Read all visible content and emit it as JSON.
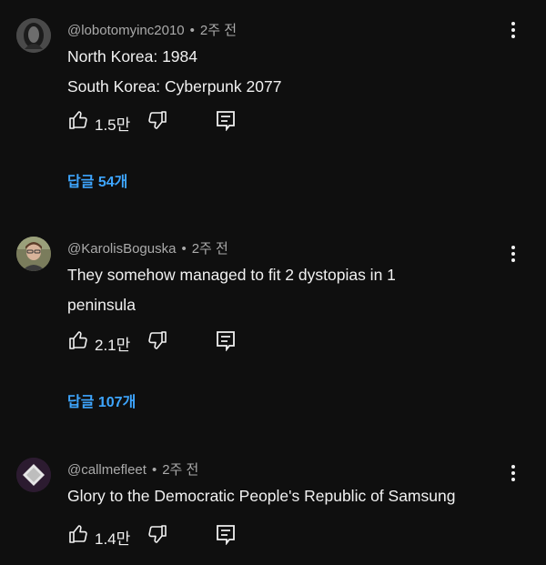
{
  "colors": {
    "background": "#0f0f0f",
    "text": "#f1f1f1",
    "meta": "#aaaaaa",
    "link": "#3ea6ff"
  },
  "comments": [
    {
      "handle": "@lobotomyinc2010",
      "separator": "•",
      "time": "2주 전",
      "lines": [
        "North Korea: 1984",
        "South Korea: Cyberpunk 2077"
      ],
      "likes": "1.5만",
      "replies": "답글 54개",
      "avatar_icon": "masked-face-avatar"
    },
    {
      "handle": "@KarolisBoguska",
      "separator": "•",
      "time": "2주 전",
      "lines": [
        "They somehow managed to fit 2 dystopias in 1",
        "peninsula"
      ],
      "likes": "2.1만",
      "replies": "답글 107개",
      "avatar_icon": "person-photo-avatar"
    },
    {
      "handle": "@callmefleet",
      "separator": "•",
      "time": "2주 전",
      "lines": [
        "Glory to the Democratic People's Republic of Samsung"
      ],
      "likes": "1.4만",
      "avatar_icon": "diamond-logo-avatar"
    }
  ],
  "icons": [
    "thumb-up-icon",
    "thumb-down-icon",
    "reply-icon",
    "more-vert-icon"
  ]
}
